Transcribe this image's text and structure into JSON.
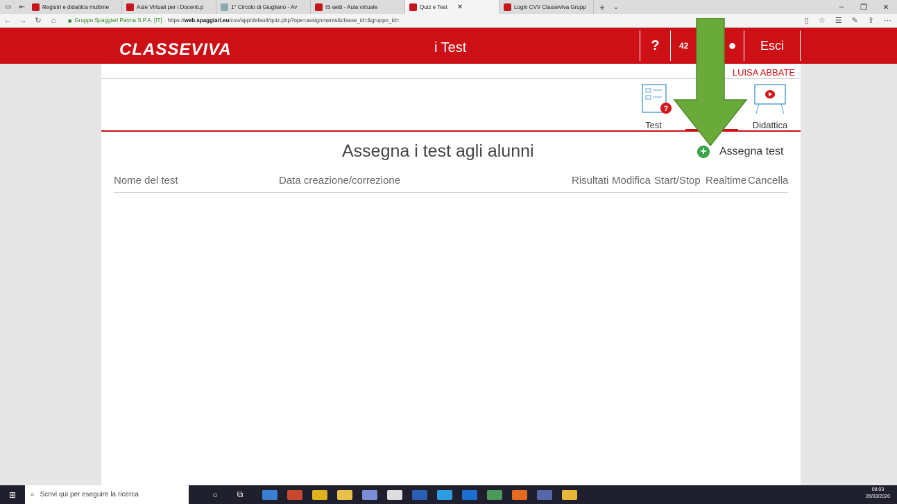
{
  "browser": {
    "tabs": [
      {
        "label": "Registri e didattica multime",
        "active": false
      },
      {
        "label": "Aule Virtuali per i Docenti.p",
        "active": false
      },
      {
        "label": "1° Circolo di Giugliano - Av",
        "active": false
      },
      {
        "label": "IS web - Aula virtuale",
        "active": false
      },
      {
        "label": "Quiz e Test",
        "active": true
      },
      {
        "label": "Login CVV Classeviva Grupp",
        "active": false
      }
    ],
    "site_identity": "Gruppo Spaggiari Parma S.P.A. [IT]",
    "url_prefix": "https://",
    "url_host": "web.spaggiari.eu",
    "url_path": "/cvv/app/default/quiz.php?ope=assignments&classe_id=&gruppo_id="
  },
  "header": {
    "logo": "CLASSEVIVA",
    "title": "i Test",
    "help": "?",
    "code": "42",
    "logout": "Esci",
    "user_name": "LUISA ABBATE"
  },
  "toolbar": {
    "test_label": "Test",
    "assegna_label": "na",
    "didattica_label": "Didattica"
  },
  "main": {
    "heading": "Assegna i test agli alunni",
    "assign_button": "Assegna test",
    "columns": [
      "Nome del test",
      "Data creazione/correzione",
      "Risultati",
      "Modifica",
      "Start/Stop",
      "Realtime",
      "Cancella"
    ]
  },
  "taskbar": {
    "search_placeholder": "Scrivi qui per eseguire la ricerca",
    "time": "08:03",
    "date": "26/03/2020"
  },
  "colors": {
    "brand_red": "#cc1016",
    "accent_green": "#3aa54a",
    "arrow_green": "#6aaa3a"
  }
}
